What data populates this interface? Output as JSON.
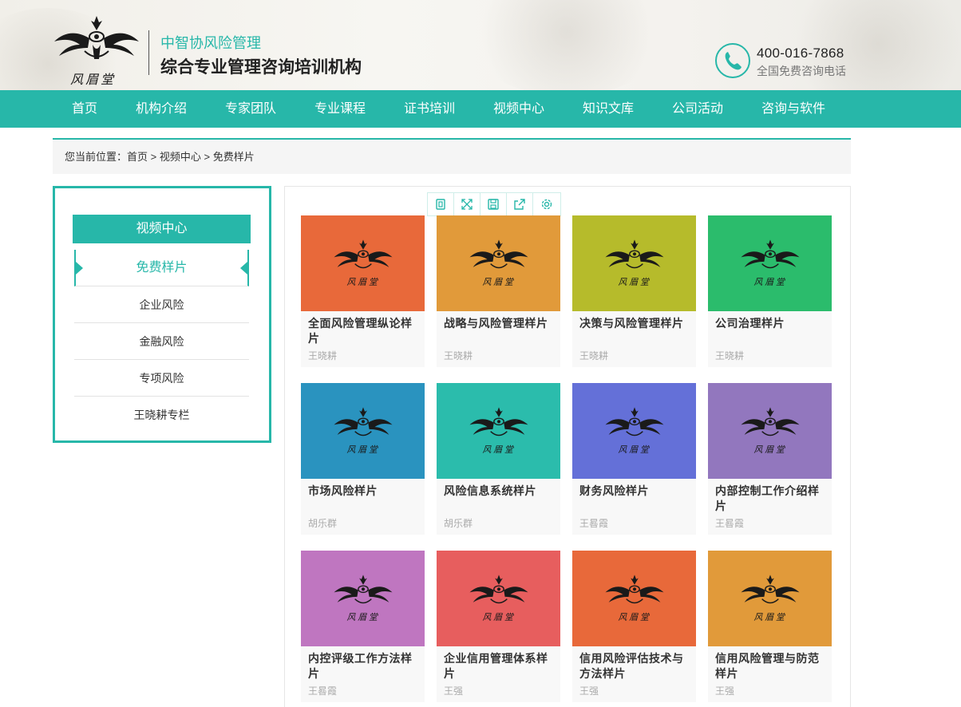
{
  "header": {
    "brand_sub": "中智协风险管理",
    "brand_main": "综合专业管理咨询培训机构",
    "phone_number": "400-016-7868",
    "phone_label": "全国免费咨询电话",
    "logo_text": "风眉堂"
  },
  "nav": {
    "items": [
      {
        "label": "首页"
      },
      {
        "label": "机构介绍"
      },
      {
        "label": "专家团队"
      },
      {
        "label": "专业课程"
      },
      {
        "label": "证书培训"
      },
      {
        "label": "视频中心"
      },
      {
        "label": "知识文库"
      },
      {
        "label": "公司活动"
      },
      {
        "label": "咨询与软件"
      }
    ]
  },
  "breadcrumb": {
    "prefix": "您当前位置：",
    "home": "首页",
    "sep1": " > ",
    "section": "视频中心",
    "sep2": " > ",
    "current": "免费样片"
  },
  "sidebar": {
    "title": "视频中心",
    "active": "免费样片",
    "items": [
      {
        "label": "企业风险"
      },
      {
        "label": "金融风险"
      },
      {
        "label": "专项风险"
      },
      {
        "label": "王晓耕专栏"
      }
    ]
  },
  "toolbar": {
    "icons": [
      "copy-icon",
      "expand-icon",
      "save-icon",
      "share-icon",
      "settings-icon"
    ]
  },
  "colors": {
    "accent": "#27b7a9",
    "card_colors": [
      "#e8693a",
      "#e19a3a",
      "#b6bb2b",
      "#2bbc6c",
      "#2a93bf",
      "#2bbcac",
      "#6470d8",
      "#9277be",
      "#bf76c0",
      "#e75e5e",
      "#e8693a",
      "#e19a3a"
    ]
  },
  "cards": [
    {
      "title": "全面风险管理纵论样片",
      "author": "王晓耕"
    },
    {
      "title": "战略与风险管理样片",
      "author": "王晓耕"
    },
    {
      "title": "决策与风险管理样片",
      "author": "王晓耕"
    },
    {
      "title": "公司治理样片",
      "author": "王晓耕"
    },
    {
      "title": "市场风险样片",
      "author": "胡乐群"
    },
    {
      "title": "风险信息系统样片",
      "author": "胡乐群"
    },
    {
      "title": "财务风险样片",
      "author": "王晷霞"
    },
    {
      "title": "内部控制工作介绍样片",
      "author": "王晷霞"
    },
    {
      "title": "内控评级工作方法样片",
      "author": "王晷霞"
    },
    {
      "title": "企业信用管理体系样片",
      "author": "王强"
    },
    {
      "title": "信用风险评估技术与方法样片",
      "author": "王强"
    },
    {
      "title": "信用风险管理与防范样片",
      "author": "王强"
    }
  ]
}
